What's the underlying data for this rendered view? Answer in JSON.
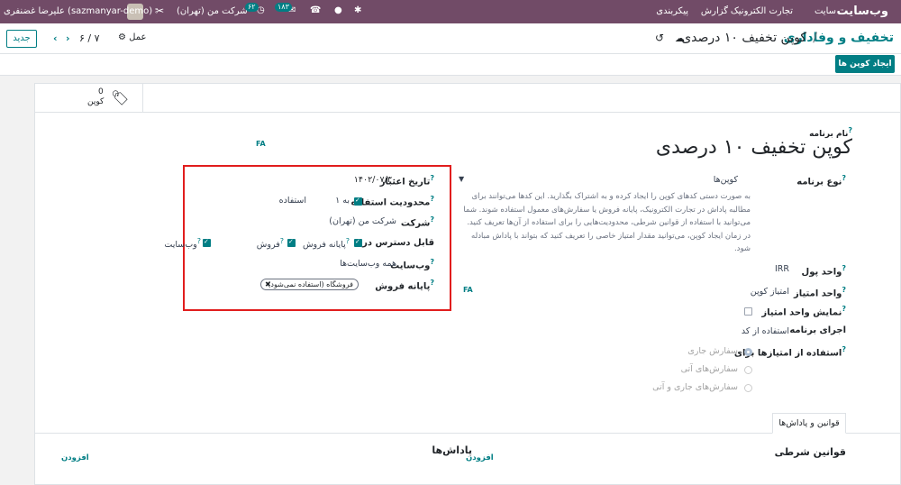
{
  "topbar": {
    "brand": "وب‌سایت",
    "menu": [
      "سایت",
      "تجارت الکترونیک",
      "گزارش",
      "پیکربندی"
    ],
    "user_name": "علیرضا غضنفری (sazmanyar-demo)",
    "company": "شرکت من (تهران)",
    "activity_count": "۶۲",
    "message_count": "۱۸۳"
  },
  "control": {
    "new_label": "جدید",
    "pager": "۶ / ۷",
    "action_label": "عمل",
    "breadcrumb_parent": "تخفیف و وفاداری",
    "breadcrumb_sep": "/",
    "breadcrumb_current": "کوپن تخفیف ۱۰ درصدی",
    "generate_coupons": "ایجاد کوپن ها"
  },
  "smart_button": {
    "count": "0",
    "label": "کوپن"
  },
  "form": {
    "name_label": "نام برنامه",
    "name_value": "کوپن تخفیف ۱۰ درصدی",
    "lang_tag": "FA",
    "program_type_label": "نوع برنامه",
    "program_type_value": "کوپن‌ها",
    "program_type_help": "به صورت دستی کدهای کوپن را ایجاد کرده و به اشتراک بگذارید. این کدها می‌توانند برای مطالبه پاداش در تجارت الکترونیک، پایانه فروش یا سفارش‌های معمول استفاده شوند. شما می‌توانید با استفاده از قوانین شرطی، محدودیت‌هایی را برای استفاده از آن‌ها تعریف کنید. در زمان ایجاد کوپن، می‌توانید مقدار امتیاز خاصی را تعریف کنید که بتواند با پاداش مبادله شود.",
    "currency_label": "واحد پول",
    "currency_value": "IRR",
    "points_unit_label": "واحد امتیاز",
    "points_unit_value": "امتیاز کوپن",
    "show_points_unit_label": "نمایش واحد امتیاز",
    "apply_label": "اجرای برنامه",
    "apply_value": "استفاده از کد",
    "use_points_label": "استفاده از امتیازها برای",
    "use_points_options": [
      "سفارش جاری",
      "سفارش‌های آتی",
      "سفارش‌های جاری و آتی"
    ],
    "validity_label": "تاریخ اعتبار",
    "validity_value": "۱۴۰۲/۰۷/۳۰",
    "limit_label": "محدودیت استفاده",
    "limit_to": "به ۱",
    "limit_unit": "استفاده",
    "company_label": "شرکت",
    "company_value": "شرکت من (تهران)",
    "available_label": "قابل دسترس در",
    "available_options": [
      "پایانه فروش",
      "فروش",
      "وب‌سایت"
    ],
    "website_label": "وب‌سایت",
    "website_value": "همه وب‌سایت‌ها",
    "pos_label": "پایانه فروش",
    "pos_tag": "فروشگاه (استفاده نمی‌شود)",
    "fa_tag2": "FA"
  },
  "tabs": {
    "rules_rewards": "قوانین و پاداش‌ها"
  },
  "rules": {
    "conditional_title": "قوانین شرطی",
    "rewards_title": "پاداش‌ها",
    "add_label": "افزودن"
  },
  "colors": {
    "brand": "#714b67",
    "accent": "#017e84",
    "highlight": "#e11d1d"
  }
}
